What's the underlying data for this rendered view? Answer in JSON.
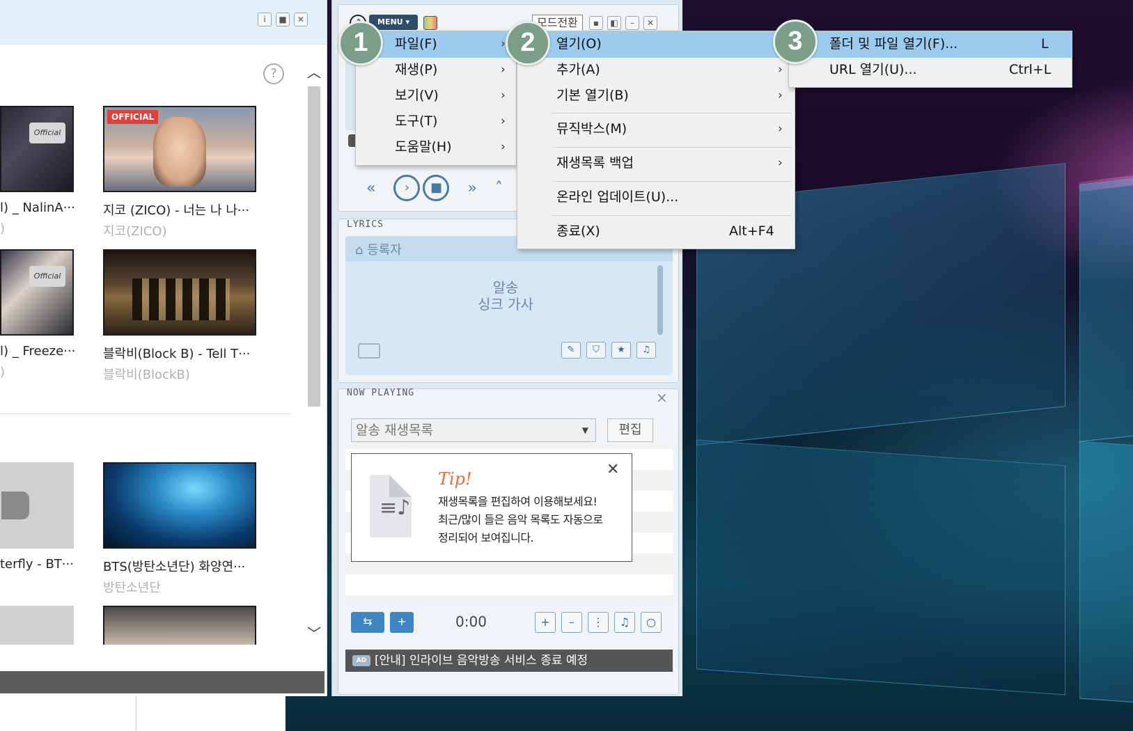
{
  "web_panel": {
    "help_label": "?",
    "videos": [
      {
        "title": "l) _ NalinA···",
        "artist": ")",
        "thumb_label": "Official"
      },
      {
        "title": "지코 (ZICO) - 너는 나 나···",
        "artist": "지코(ZICO)",
        "thumb_label": "OFFICIAL"
      },
      {
        "title": "l) _ Freeze···",
        "artist": ")",
        "thumb_label": "Official"
      },
      {
        "title": "블락비(Block B) - Tell T···",
        "artist": "블락비(BlockB)",
        "thumb_label": ""
      },
      {
        "title": "terfly - BT···",
        "artist": "",
        "thumb_label": ""
      },
      {
        "title": "BTS(방탄소년단) 화양연···",
        "artist": "방탄소년단",
        "thumb_label": ""
      }
    ]
  },
  "player": {
    "menu_label": "MENU",
    "mode_switch_label": "모드전환",
    "lyrics_section_label": "LYRICS",
    "lyrics_registrant": "등록자",
    "lyrics_text_line1": "알송",
    "lyrics_text_line2": "싱크 가사",
    "now_playing_label": "NOW PLAYING",
    "playlist_select_value": "알송 재생목록",
    "edit_button_label": "편집",
    "tip": {
      "title": "Tip!",
      "line1": "재생목록을 편집하여 이용해보세요!",
      "line2": "최근/많이 들은 음악 목록도 자동으로",
      "line3": "정리되어 보여집니다."
    },
    "time": "0:00",
    "ad_badge": "AD",
    "ad_text": "[안내] 인라이브 음악방송 서비스 종료 예정"
  },
  "menu1": {
    "items": [
      {
        "label": "파일(F)"
      },
      {
        "label": "재생(P)"
      },
      {
        "label": "보기(V)"
      },
      {
        "label": "도구(T)"
      },
      {
        "label": "도움말(H)"
      }
    ]
  },
  "menu2": {
    "items": [
      {
        "label": "열기(O)",
        "shortcut": ""
      },
      {
        "label": "추가(A)",
        "shortcut": ""
      },
      {
        "label": "기본 열기(B)",
        "shortcut": ""
      },
      {
        "label": "뮤직박스(M)",
        "shortcut": ""
      },
      {
        "label": "재생목록 백업",
        "shortcut": ""
      },
      {
        "label": "온라인 업데이트(U)...",
        "shortcut": ""
      },
      {
        "label": "종료(X)",
        "shortcut": "Alt+F4"
      }
    ]
  },
  "menu3": {
    "items": [
      {
        "label": "폴더 및 파일 열기(F)...",
        "shortcut": "L"
      },
      {
        "label": "URL 열기(U)...",
        "shortcut": "Ctrl+L"
      }
    ]
  },
  "steps": [
    "1",
    "2",
    "3"
  ],
  "colors": {
    "menu_highlight": "#9ccbf0",
    "step_badge": "#7a9e8a",
    "tip_title": "#e86a3a",
    "ad_bar": "#555555"
  }
}
